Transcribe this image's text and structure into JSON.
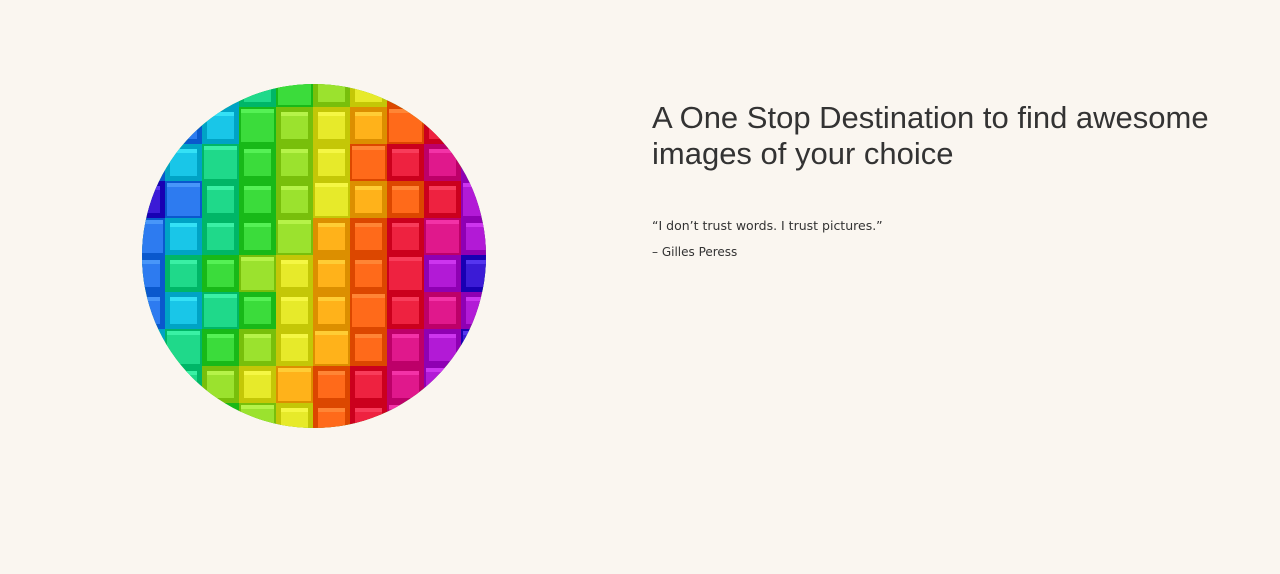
{
  "hero": {
    "image": {
      "icon": "rainbow-cubes-image",
      "palette": [
        "#3b1bd6",
        "#2d7bf0",
        "#19c6e8",
        "#1fd98a",
        "#3bdc3b",
        "#9be22e",
        "#e7ea2a",
        "#ffb21a",
        "#ff6a1a",
        "#ee2240",
        "#e0188c",
        "#b21ad6"
      ]
    },
    "headline": "A One Stop Destination to find awesome images of your choice",
    "quote": "“I don’t trust words. I trust pictures.”",
    "quote_author": "– Gilles Peress"
  }
}
